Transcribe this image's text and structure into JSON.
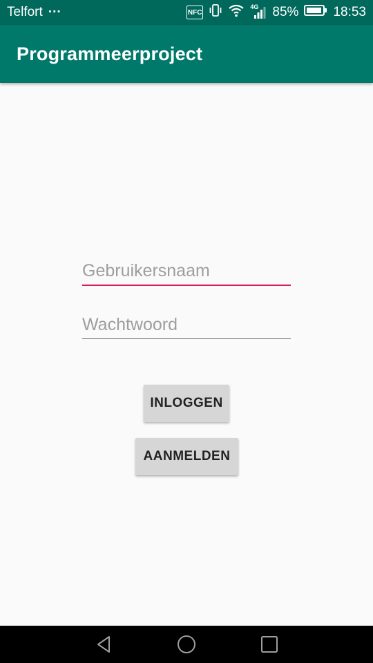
{
  "status_bar": {
    "carrier": "Telfort",
    "more": "···",
    "nfc": "NFC",
    "network": "4G",
    "battery": "85%",
    "time": "18:53"
  },
  "app_bar": {
    "title": "Programmeerproject"
  },
  "form": {
    "username_placeholder": "Gebruikersnaam",
    "username_value": "",
    "password_placeholder": "Wachtwoord",
    "password_value": "",
    "login_label": "INLOGGEN",
    "register_label": "AANMELDEN"
  },
  "colors": {
    "status_bar": "#00695c",
    "app_bar": "#00796b",
    "accent": "#d81b60",
    "background": "#fafafa",
    "button": "#d6d6d6"
  },
  "nav_bar": {
    "icons": [
      "back-icon",
      "home-icon",
      "recents-icon"
    ]
  }
}
